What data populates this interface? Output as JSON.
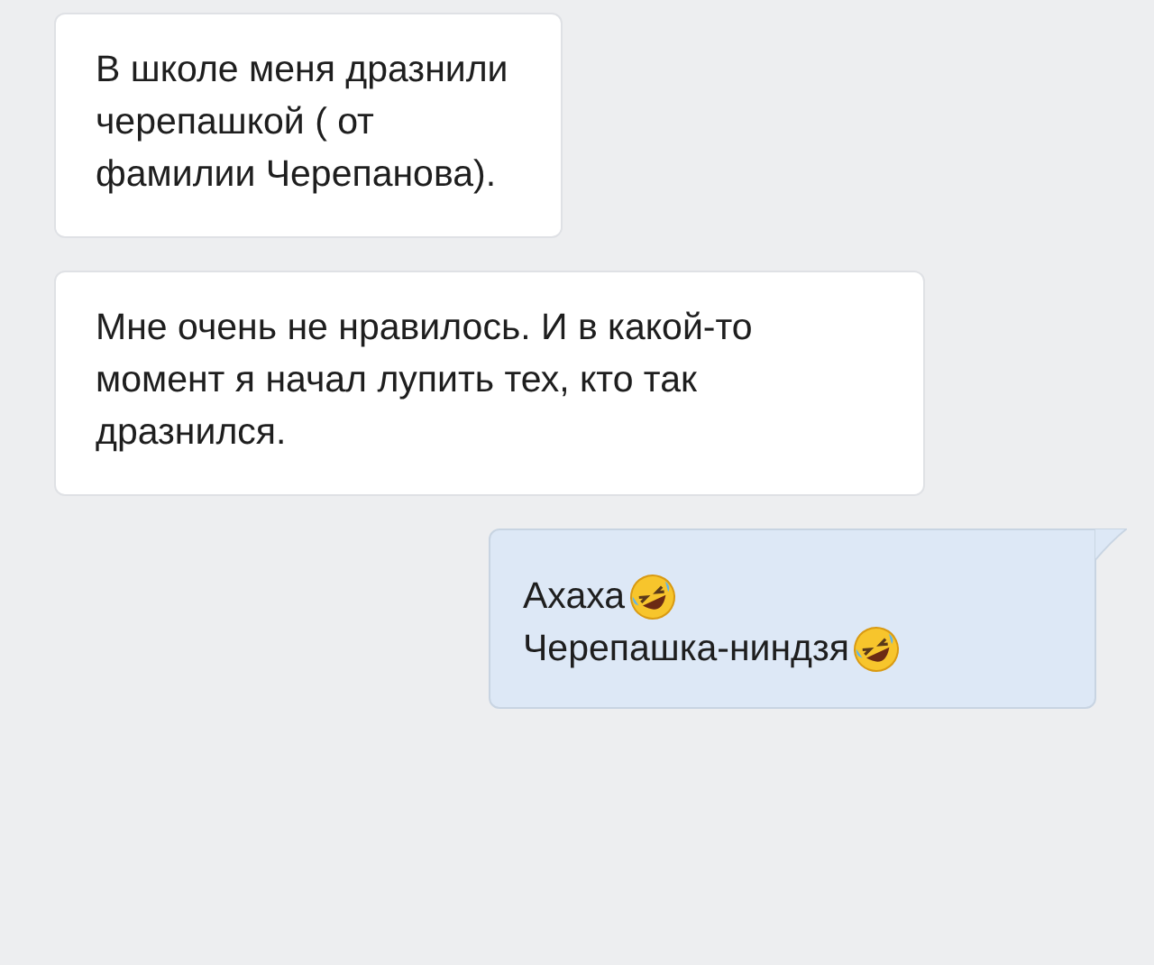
{
  "messages": [
    {
      "kind": "incoming",
      "lines": [
        {
          "text": "В школе меня дразнили черепашкой ( от фамилии Черепанова).",
          "emoji": false
        }
      ]
    },
    {
      "kind": "incoming",
      "lines": [
        {
          "text": "Мне очень не нравилось. И в какой-то момент я начал лупить тех, кто так дразнился.",
          "emoji": false
        }
      ]
    },
    {
      "kind": "outgoing",
      "lines": [
        {
          "text": "Ахаха",
          "emoji": true
        },
        {
          "text": "Черепашка-ниндзя",
          "emoji": true
        }
      ]
    }
  ]
}
